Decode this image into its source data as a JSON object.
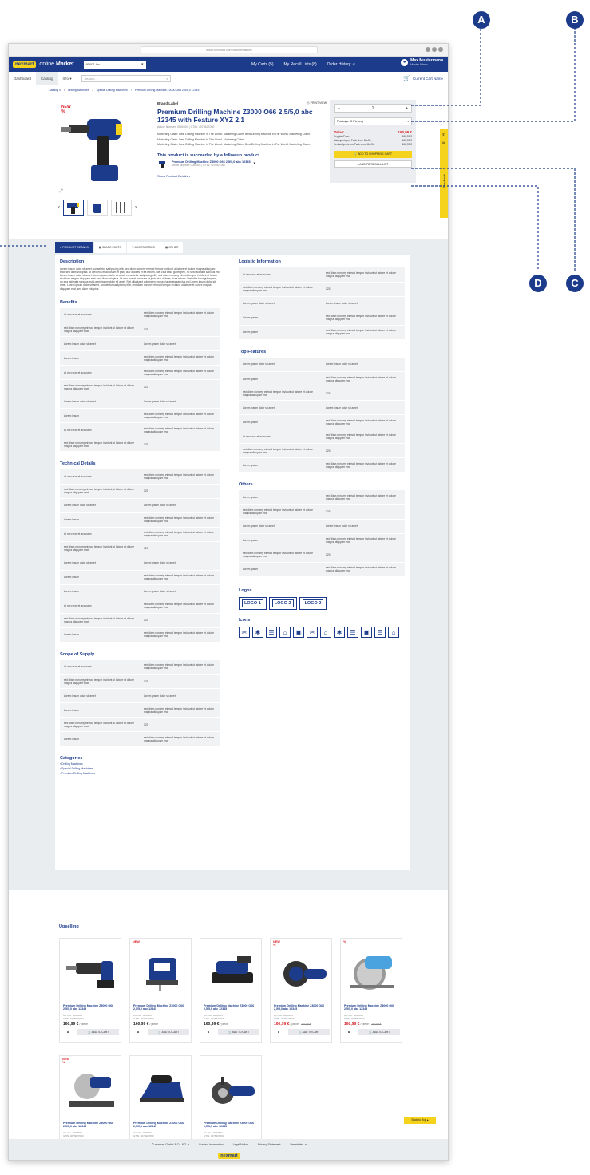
{
  "browser": {
    "url": "www.nexmart.com/onlinemarket/"
  },
  "topnav": {
    "logo": "nexmart",
    "brand": "online",
    "brand_bold": "Market",
    "customer": "90001 Inc.",
    "links": [
      "My Carts (5)",
      "My Recall Lists (8)",
      "Order History"
    ],
    "user_name": "Max Mustermann",
    "user_role": "Master Admin"
  },
  "subnav": {
    "tabs": [
      "Dashboard",
      "Catalog",
      "Info"
    ],
    "search_placeholder": "Search...",
    "cart": "Current Cart Name"
  },
  "breadcrumb": [
    "Catalog 0",
    "/",
    "Drilling Machines",
    "/",
    "Special Drilling Machines",
    "/",
    "Premium Drilling Machine Z3000 O66 2,5/5,0 12345"
  ],
  "product": {
    "new_label": "NEW",
    "percent_label": "%",
    "brand": "Brand Label",
    "print": "PRINT VIEW",
    "title": "Premium Drilling Machine Z3000 O66 2,5/5,0 abc 12345 with Feature XYZ 2.1",
    "article": "Article Number: 0060504  |  GTIN: 4076627060",
    "claims": [
      "Marketing Claim: Best Drilling Machine in The World. Marketing Claim. Best Drilling Machine in The World. Marketing Claim.",
      "Marketing Claim. Best Drilling Machine In The World. Marketing Claim.",
      "Marketing Claim: Best Drilling Machine in The World. Marketing Claim. Best Drilling Machine in The World. Marketing Claim."
    ],
    "successor_heading": "This product is succeeded by a followup product",
    "successor_name": "Premium Drilling Machine Z3000 O66 2,5/5,0 abc 12345",
    "successor_meta": "Article Number: 0060504  |  GTIN: 4076627060",
    "show_details": "Show Product Details"
  },
  "buybox": {
    "minus": "−",
    "qty": "1",
    "plus": "+",
    "package": "Package (5 Pieces)",
    "value_label": "Value:",
    "value": "160,99 €",
    "prices": [
      [
        "Regular Price:",
        "160,99 €"
      ],
      [
        "Listenpreis pro Pack ohne MwSt.:",
        "160,99 €"
      ],
      [
        "Verkaufspreis pro Pack ohne MwSt.:",
        "160,99 €"
      ]
    ],
    "add_cart": "ADD TO SHOPPING CART",
    "add_recall": "ADD TO RECALL LIST"
  },
  "sidetab": {
    "label": "Feedback"
  },
  "tabs": [
    "PRODUCT DETAILS",
    "SPARE PARTS",
    "ACCESSORIES",
    "OTHER"
  ],
  "description": {
    "title": "Description",
    "text": "Lorem ipsum dolor sit amet, consetetur sadipscing elitr, sed diam nonumy eirmod tempor invidunt ut labore et dolore magna aliquyam erat, sed diam voluptua. At vero eos et accusam et justo duo dolores et ea rebum. Stet clita kasd gubergren, no sea takimata sanctus est Lorem ipsum dolor sit amet. Lorem ipsum dolor sit amet, consetetur sadipscing elitr, sed diam nonumy eirmod tempor invidunt ut labore et dolore magna aliquyam erat, sed diam voluptua. At vero eos et accusam et justo duo dolores et ea rebum. Stet clita kasd gubergren, no sea takimata sanctus est Lorem ipsum dolor sit amet. Stet clita kasd gubergren, no sea takimata sanctus est Lorem ipsum dolor sit amet. Lorem ipsum dolor sit amet, consetetur sadipscing elitr, sed diam nonumy eirmod tempor invidunt ut labore et dolore magna aliquyam erat, sed diam voluptua."
  },
  "benefits": {
    "title": "Benefits",
    "rows": [
      [
        "At vero eos et accusam",
        "sed diam nonumy eirmod tempor invidunt ut labore et dolore magna aliquyam erat"
      ],
      [
        "sed diam nonumy eirmod tempor invidunt ut labore et dolore magna aliquyam erat",
        "123"
      ],
      [
        "Lorem ipsum dolor sit amet",
        "Lorem ipsum dolor sit amet"
      ],
      [
        "Lorem ipsum",
        "sed diam nonumy eirmod tempor invidunt ut labore et dolore magna aliquyam erat"
      ],
      [
        "At vero eos et accusam",
        "sed diam nonumy eirmod tempor invidunt ut labore et dolore magna aliquyam erat"
      ],
      [
        "sed diam nonumy eirmod tempor invidunt ut labore et dolore magna aliquyam erat",
        "123"
      ],
      [
        "Lorem ipsum dolor sit amet",
        "Lorem ipsum dolor sit amet"
      ],
      [
        "Lorem ipsum",
        "sed diam nonumy eirmod tempor invidunt ut labore et dolore magna aliquyam erat"
      ],
      [
        "At vero eos et accusam",
        "sed diam nonumy eirmod tempor invidunt ut labore et dolore magna aliquyam erat"
      ],
      [
        "sed diam nonumy eirmod tempor invidunt ut labore et dolore magna aliquyam erat",
        "123"
      ]
    ]
  },
  "technical": {
    "title": "Technical Details",
    "rows": [
      [
        "At vero eos et accusam",
        "sed diam nonumy eirmod tempor invidunt ut labore et dolore magna aliquyam erat"
      ],
      [
        "sed diam nonumy eirmod tempor invidunt ut labore et dolore magna aliquyam erat",
        "123"
      ],
      [
        "Lorem ipsum dolor sit amet",
        "Lorem ipsum dolor sit amet"
      ],
      [
        "Lorem ipsum",
        "sed diam nonumy eirmod tempor invidunt ut labore et dolore magna aliquyam erat"
      ],
      [
        "At vero eos et accusam",
        "sed diam nonumy eirmod tempor invidunt ut labore et dolore magna aliquyam erat"
      ],
      [
        "sed diam nonumy eirmod tempor invidunt ut labore et dolore magna aliquyam erat",
        "123"
      ],
      [
        "Lorem ipsum dolor sit amet",
        "Lorem ipsum dolor sit amet"
      ],
      [
        "Lorem ipsum",
        "sed diam nonumy eirmod tempor invidunt ut labore et dolore magna aliquyam erat"
      ],
      [
        "Lorem ipsum",
        "Lorem ipsum dolor sit amet"
      ],
      [
        "At vero eos et accusam",
        "sed diam nonumy eirmod tempor invidunt ut labore et dolore magna aliquyam erat"
      ],
      [
        "sed diam nonumy eirmod tempor invidunt ut labore et dolore magna aliquyam erat",
        "123"
      ],
      [
        "Lorem ipsum",
        "sed diam nonumy eirmod tempor invidunt ut labore et dolore magna aliquyam erat"
      ]
    ]
  },
  "scope": {
    "title": "Scope of Supply",
    "rows": [
      [
        "At vero eos et accusam",
        "sed diam nonumy eirmod tempor invidunt ut labore et dolore magna aliquyam erat"
      ],
      [
        "sed diam nonumy eirmod tempor invidunt ut labore et dolore magna aliquyam erat",
        "123"
      ],
      [
        "Lorem ipsum dolor sit amet",
        "Lorem ipsum dolor sit amet"
      ],
      [
        "Lorem ipsum",
        "sed diam nonumy eirmod tempor invidunt ut labore et dolore magna aliquyam erat"
      ],
      [
        "sed diam nonumy eirmod tempor invidunt ut labore et dolore magna aliquyam erat",
        "123"
      ],
      [
        "Lorem ipsum",
        "sed diam nonumy eirmod tempor invidunt ut labore et dolore magna aliquyam erat"
      ]
    ]
  },
  "categories": {
    "title": "Categories",
    "items": [
      "Drilling Machines",
      "Special Drilling Machines",
      "Premium Drilling Machines"
    ]
  },
  "logistic": {
    "title": "Logistic Information",
    "rows": [
      [
        "At vero eos et accusam",
        "sed diam nonumy eirmod tempor invidunt ut labore et dolore magna aliquyam erat"
      ],
      [
        "sed diam nonumy eirmod tempor invidunt ut labore et dolore magna aliquyam erat",
        "123"
      ],
      [
        "Lorem ipsum dolor sit amet",
        "Lorem ipsum dolor sit amet"
      ],
      [
        "Lorem ipsum",
        "sed diam nonumy eirmod tempor invidunt ut labore et dolore magna aliquyam erat"
      ],
      [
        "Lorem ipsum",
        "sed diam nonumy eirmod tempor invidunt ut labore et dolore magna aliquyam erat"
      ]
    ]
  },
  "topfeatures": {
    "title": "Top Features",
    "rows": [
      [
        "Lorem ipsum dolor sit amet",
        "Lorem ipsum dolor sit amet"
      ],
      [
        "Lorem ipsum",
        "sed diam nonumy eirmod tempor invidunt ut labore et dolore magna aliquyam erat"
      ],
      [
        "sed diam nonumy eirmod tempor invidunt ut labore et dolore magna aliquyam erat",
        "123"
      ],
      [
        "Lorem ipsum dolor sit amet",
        "Lorem ipsum dolor sit amet"
      ],
      [
        "Lorem ipsum",
        "sed diam nonumy eirmod tempor invidunt ut labore et dolore magna aliquyam erat"
      ],
      [
        "At vero eos et accusam",
        "sed diam nonumy eirmod tempor invidunt ut labore et dolore magna aliquyam erat"
      ],
      [
        "sed diam nonumy eirmod tempor invidunt ut labore et dolore magna aliquyam erat",
        "123"
      ],
      [
        "Lorem ipsum",
        "sed diam nonumy eirmod tempor invidunt ut labore et dolore magna aliquyam erat"
      ]
    ]
  },
  "others": {
    "title": "Others",
    "rows": [
      [
        "Lorem ipsum",
        "sed diam nonumy eirmod tempor invidunt ut labore et dolore magna aliquyam erat"
      ],
      [
        "sed diam nonumy eirmod tempor invidunt ut labore et dolore magna aliquyam erat",
        "123"
      ],
      [
        "Lorem ipsum dolor sit amet",
        "Lorem ipsum dolor sit amet"
      ],
      [
        "Lorem ipsum",
        "sed diam nonumy eirmod tempor invidunt ut labore et dolore magna aliquyam erat"
      ],
      [
        "sed diam nonumy eirmod tempor invidunt ut labore et dolore magna aliquyam erat",
        "123"
      ],
      [
        "Lorem ipsum",
        "sed diam nonumy eirmod tempor invidunt ut labore et dolore magna aliquyam erat"
      ]
    ]
  },
  "logos": {
    "title": "Logos",
    "items": [
      "LOGO 1",
      "LOGO 2",
      "LOGO 2"
    ]
  },
  "icons": {
    "title": "Icons",
    "items": [
      "tools-icon",
      "snowflake-icon",
      "menu-icon",
      "home-icon",
      "toolbox-icon",
      "tools-icon",
      "home-icon",
      "snowflake-icon",
      "menu-icon",
      "toolbox-icon",
      "menu-icon",
      "home-icon"
    ]
  },
  "upselling": {
    "title": "Upselling",
    "products": [
      {
        "new": "",
        "pct": "",
        "name": "Premium Drilling Machine Z3000 O66 2,5/5,0 abc 12345",
        "art": "Art.-No.: 0060504",
        "gtin": "GTIN: 4076627060",
        "price": "160,99 €",
        "unit": " / piece",
        "old": "",
        "qty": "8",
        "cart": "ADD TO CART",
        "img": "hammer-drill"
      },
      {
        "new": "NEW",
        "pct": "",
        "name": "Premium Drilling Machine Z3000 O66 2,5/5,0 abc 12345",
        "art": "Art.-No.: 0060504",
        "gtin": "GTIN: 4076627060",
        "price": "160,99 €",
        "unit": " / piece",
        "old": "",
        "qty": "8",
        "cart": "ADD TO CART",
        "img": "jigsaw"
      },
      {
        "new": "",
        "pct": "",
        "name": "Premium Drilling Machine Z3000 O66 2,5/5,0 abc 12345",
        "art": "Art.-No.: 0060504",
        "gtin": "GTIN: 4076627060",
        "price": "160,99 €",
        "unit": " / piece",
        "old": "",
        "qty": "8",
        "cart": "ADD TO CART",
        "img": "sander"
      },
      {
        "new": "NEW",
        "pct": "%",
        "name": "Premium Drilling Machine Z3000 O66 2,5/5,0 abc 12345",
        "art": "Art.-No.: 0060504",
        "gtin": "GTIN: 4076627060",
        "price": "160,99 €",
        "unit": " / piece",
        "old": "193,99 €",
        "qty": "8",
        "cart": "ADD TO CART",
        "img": "grinder"
      },
      {
        "new": "",
        "pct": "%",
        "name": "Premium Drilling Machine Z3000 O66 2,5/5,0 abc 12345",
        "art": "Art.-No.: 0060504",
        "gtin": "GTIN: 4076627060",
        "price": "160,99 €",
        "unit": " / piece",
        "old": "193,99 €",
        "qty": "8",
        "cart": "ADD TO CART",
        "img": "circular-saw"
      },
      {
        "new": "NEW",
        "pct": "%",
        "name": "Premium Drilling Machine Z3000 O66 2,5/5,0 abc 12345",
        "art": "Art.-No.: 0060504",
        "gtin": "GTIN: 4076627060",
        "price": "160,99 €",
        "unit": " / piece",
        "old": "193,99 €",
        "qty": "8",
        "cart": "ADD TO CART",
        "img": "miter-saw"
      },
      {
        "new": "",
        "pct": "",
        "name": "Premium Drilling Machine Z3000 O66 2,5/5,0 abc 12345",
        "art": "Art.-No.: 0060504",
        "gtin": "GTIN: 4076627060",
        "price": "160,99 €",
        "unit": " / piece",
        "old": "",
        "qty": "8",
        "cart": "ADD TO CART",
        "img": "planer"
      },
      {
        "new": "",
        "pct": "",
        "name": "Premium Drilling Machine Z3000 O66 2,5/5,0 abc 12345",
        "art": "Art.-No.: 0060504",
        "gtin": "GTIN: 4076627060",
        "price": "160,99 €",
        "unit": " / piece",
        "old": "",
        "qty": "8",
        "cart": "ADD TO CART",
        "img": "angle-grinder"
      }
    ]
  },
  "backtop": "Back to Top",
  "footer": {
    "links": [
      "© nexmart GmbH & Co. KG",
      "Contact Information",
      "Legal Notice",
      "Privacy Statement",
      "Newsletter"
    ],
    "logo": "nexmart"
  },
  "annotations": [
    "A",
    "B",
    "C",
    "D"
  ],
  "colors": {
    "brand": "#1c3b8a",
    "accent": "#f5d21c",
    "sale": "#d8232a"
  }
}
